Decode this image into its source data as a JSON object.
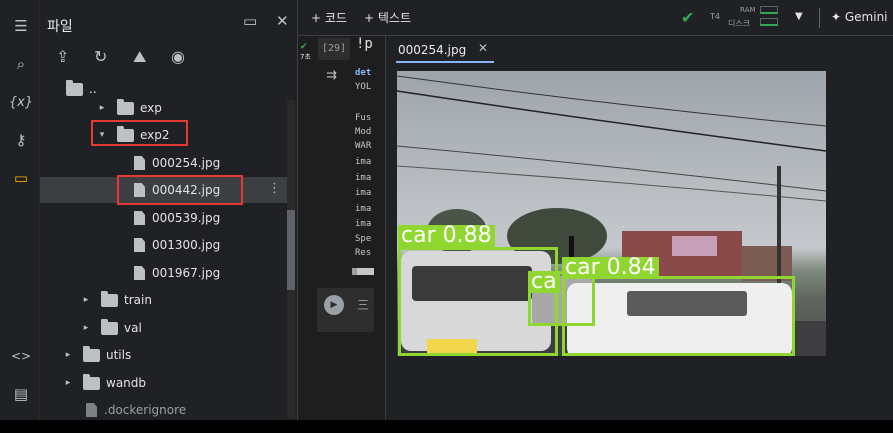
{
  "activity_bar": {
    "items": [
      {
        "name": "toc-icon",
        "glyph": "☰"
      },
      {
        "name": "search-icon",
        "glyph": "⌕"
      },
      {
        "name": "variables-icon",
        "glyph": "{x}"
      },
      {
        "name": "key-icon",
        "glyph": "⚷"
      },
      {
        "name": "folder-icon",
        "glyph": "▭"
      }
    ],
    "bottom_items": [
      {
        "name": "code-snippets-icon",
        "glyph": "<>"
      },
      {
        "name": "terminal-icon",
        "glyph": "▤"
      }
    ]
  },
  "files_panel": {
    "title": "파일",
    "tree": [
      {
        "type": "folder-up",
        "label": "..",
        "caret": ""
      },
      {
        "type": "folder",
        "label": "exp",
        "caret": "▸"
      },
      {
        "type": "folder",
        "label": "exp2",
        "caret": "▾"
      },
      {
        "type": "file",
        "label": "000254.jpg"
      },
      {
        "type": "file",
        "label": "000442.jpg"
      },
      {
        "type": "file",
        "label": "000539.jpg"
      },
      {
        "type": "file",
        "label": "001300.jpg"
      },
      {
        "type": "file",
        "label": "001967.jpg"
      },
      {
        "type": "folder",
        "label": "train",
        "caret": "▸"
      },
      {
        "type": "folder",
        "label": "val",
        "caret": "▸"
      },
      {
        "type": "folder",
        "label": "utils",
        "caret": "▸"
      },
      {
        "type": "folder",
        "label": "wandb",
        "caret": "▸"
      },
      {
        "type": "file",
        "label": ".dockerignore"
      }
    ]
  },
  "toolbar": {
    "add_code": "+ 코드",
    "add_text": "+ 텍스트",
    "runtime": "T4",
    "ram_label": "RAM",
    "disk_label": "디스크",
    "gemini": "✦ Gemini"
  },
  "notebook": {
    "cell_number": "[29]",
    "cell_code": "!p",
    "cell_time": "7초",
    "output_lines": [
      "det",
      "YOL",
      "",
      "Fus",
      "Mod",
      "WAR",
      "ima",
      "ima",
      "ima",
      "ima",
      "ima",
      "Spe",
      "Res"
    ],
    "text_cell": "三"
  },
  "viewer": {
    "tab_label": "000254.jpg",
    "detections": [
      {
        "label": "car 0.88"
      },
      {
        "label": "ca"
      },
      {
        "label": "car 0.84"
      }
    ]
  },
  "colors": {
    "accent_orange": "#f9ab00",
    "selection_red": "#e53935",
    "detection_green": "#8fd631",
    "tab_blue": "#8ab4f8"
  }
}
